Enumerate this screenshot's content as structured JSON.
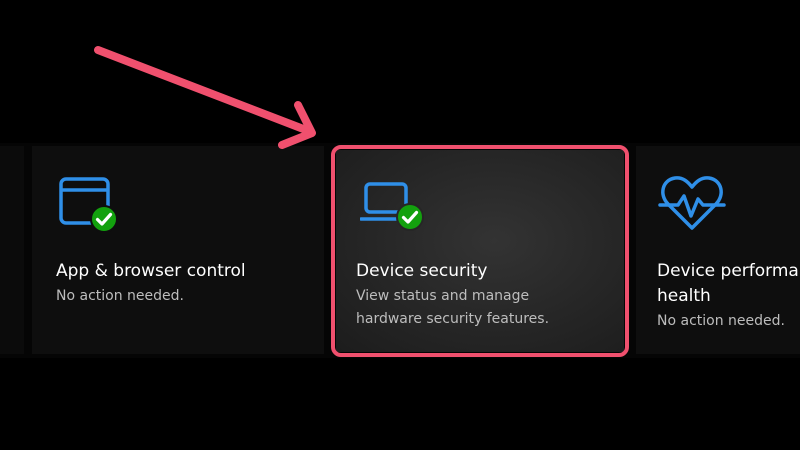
{
  "colors": {
    "accent_icon": "#2f8fe8",
    "check_badge": "#13a10e",
    "highlight": "#f0506e",
    "arrow": "#f0506e"
  },
  "tiles": [
    {
      "title": "App & browser control",
      "description": "No action needed.",
      "icon": "app-browser-window-icon",
      "status_icon": "check-badge-icon"
    },
    {
      "title": "Device security",
      "description_line1": "View status and manage",
      "description_line2": "hardware security features.",
      "icon": "device-laptop-icon",
      "status_icon": "check-badge-icon",
      "highlighted": true
    },
    {
      "title_line1": "Device performance &",
      "title_line2": "health",
      "description": "No action needed.",
      "icon": "heart-pulse-icon"
    }
  ],
  "annotation": {
    "type": "arrow",
    "points_to": "Device security"
  }
}
